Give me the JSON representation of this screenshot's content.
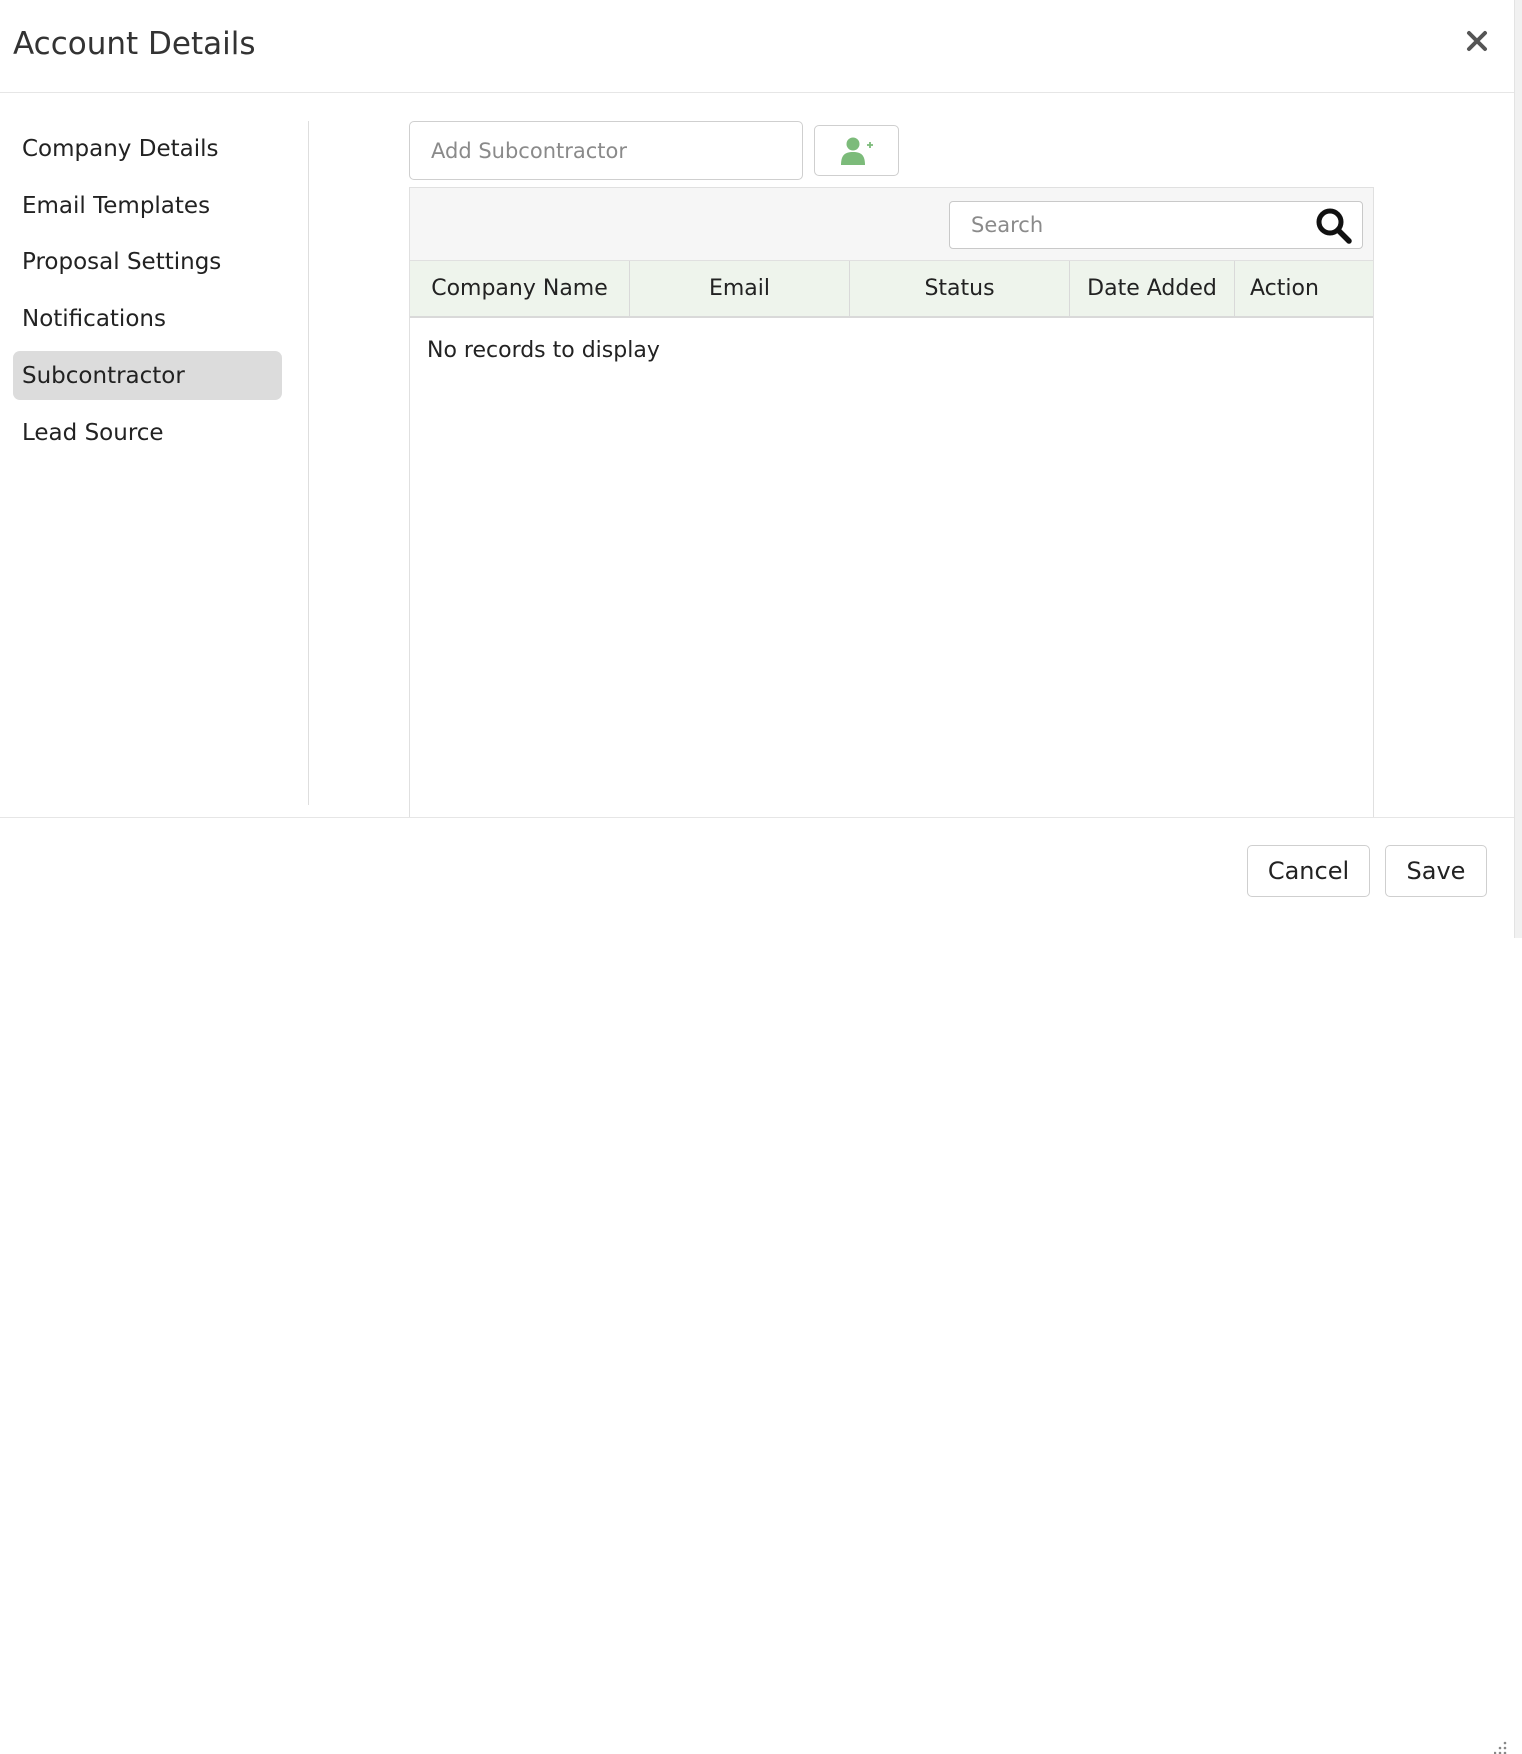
{
  "dialog": {
    "title": "Account Details",
    "close_icon": "close-icon"
  },
  "sidebar": {
    "items": [
      {
        "label": "Company Details",
        "active": false
      },
      {
        "label": "Email Templates",
        "active": false
      },
      {
        "label": "Proposal Settings",
        "active": false
      },
      {
        "label": "Notifications",
        "active": false
      },
      {
        "label": "Subcontractor",
        "active": true
      },
      {
        "label": "Lead Source",
        "active": false
      }
    ]
  },
  "subcontractor": {
    "add_input": {
      "placeholder": "Add Subcontractor",
      "value": ""
    },
    "add_button_icon": "add-user-icon",
    "search": {
      "placeholder": "Search",
      "value": "",
      "icon": "search-icon"
    },
    "columns": [
      "Company Name",
      "Email",
      "Status",
      "Date Added",
      "Action"
    ],
    "rows": [],
    "empty_message": "No records to display"
  },
  "footer": {
    "cancel_label": "Cancel",
    "save_label": "Save"
  },
  "colors": {
    "accent_green": "#7cbb7a",
    "header_bg": "#eef4ec",
    "active_nav_bg": "#dcdcdc"
  }
}
